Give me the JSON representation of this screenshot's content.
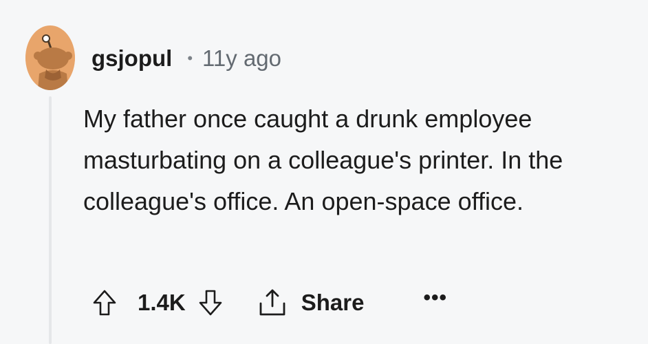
{
  "comment": {
    "avatar_icon": "reddit-snoo-avatar-icon",
    "username": "gsjopul",
    "separator": "•",
    "timestamp": "11y ago",
    "body": "My father once caught a drunk employee masturbating on a colleague's printer. In the colleague's office. An open-space office."
  },
  "actions": {
    "upvote_icon": "arrow-up-icon",
    "score": "1.4K",
    "downvote_icon": "arrow-down-icon",
    "share_icon": "share-icon",
    "share_label": "Share",
    "more_label": "•••"
  },
  "colors": {
    "background": "#f6f7f8",
    "avatar": "#e8a56b",
    "text": "#1c1c1c",
    "muted": "#636a71",
    "thread_line": "#e5e7e9"
  }
}
